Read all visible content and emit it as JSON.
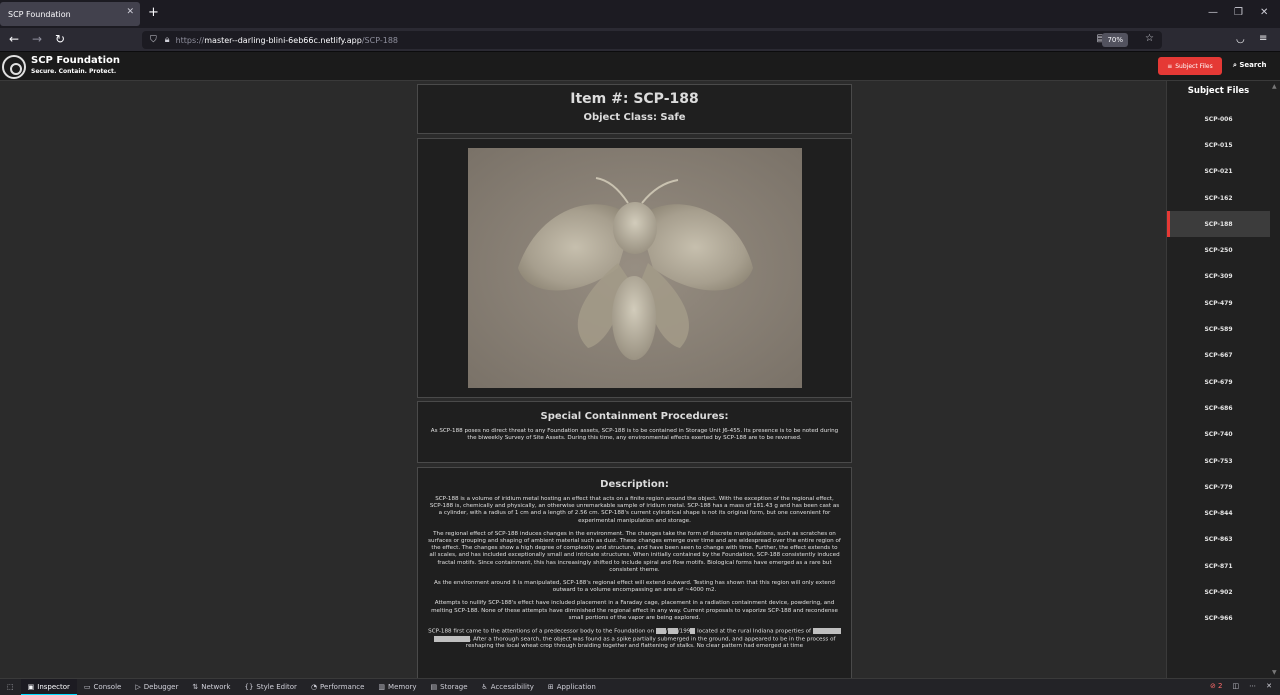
{
  "browser": {
    "tab_title": "SCP Foundation",
    "url_prefix": "https://",
    "url_host": "master--darling-blini-6eb66c.netlify.app",
    "url_path": "/SCP-188",
    "zoom": "70%"
  },
  "site": {
    "title": "SCP Foundation",
    "tagline": "Secure. Contain. Protect.",
    "subject_files_button": "Subject Files",
    "search_label": "Search"
  },
  "item": {
    "number": "Item #: SCP-188",
    "object_class": "Object Class: Safe"
  },
  "containment": {
    "heading": "Special Containment Procedures:",
    "text": "As SCP-188 poses no direct threat to any Foundation assets, SCP-188 is to be contained in Storage Unit J6-455. Its presence is to be noted during the biweekly Survey of Site Assets. During this time, any environmental effects exerted by SCP-188 are to be reversed."
  },
  "description": {
    "heading": "Description:",
    "p1": "SCP-188 is a volume of iridium metal hosting an effect that acts on a finite region around the object. With the exception of the regional effect, SCP-188 is, chemically and physically, an otherwise unremarkable sample of iridium metal. SCP-188 has a mass of 181.43 g and has been cast as a cylinder, with a radius of 1 cm and a length of 2.56 cm. SCP-188's current cylindrical shape is not its original form, but one convenient for experimental manipulation and storage.",
    "p2": "The regional effect of SCP-188 induces changes in the environment. The changes take the form of discrete manipulations, such as scratches on surfaces or grouping and shaping of ambient material such as dust. These changes emerge over time and are widespread over the entire region of the effect. The changes show a high degree of complexity and structure, and have been seen to change with time. Further, the effect extends to all scales, and has included exceptionally small and intricate structures. When initially contained by the Foundation, SCP-188 consistently induced fractal motifs. Since containment, this has increasingly shifted to include spiral and flow motifs. Biological forms have emerged as a rare but consistent theme.",
    "p3": "As the environment around it is manipulated, SCP-188's regional effect will extend outward. Testing has shown that this region will only extend outward to a volume encompassing an area of ~4000 m2.",
    "p4": "Attempts to nullify SCP-188's effect have included placement in a Faraday cage, placement in a radiation containment device, powdering, and melting SCP-188. None of these attempts have diminished the regional effect in any way. Current proposals to vaporize SCP-188 and recondense small portions of the vapor are being explored.",
    "p5_a": "SCP-188 first came to the attentions of a predecessor body to the Foundation on",
    "p5_b": "/199",
    "p5_c": "located at the rural Indiana properties of",
    "p5_d": ". After a thorough search, the object was found as a spike partially submerged in the ground, and appeared to be in the process of reshaping the local wheat crop through braiding together and flattening of stalks. No clear pattern had emerged at time"
  },
  "sidebar": {
    "heading": "Subject Files",
    "items": [
      "SCP-006",
      "SCP-015",
      "SCP-021",
      "SCP-162",
      "SCP-188",
      "SCP-250",
      "SCP-309",
      "SCP-479",
      "SCP-589",
      "SCP-667",
      "SCP-679",
      "SCP-686",
      "SCP-740",
      "SCP-753",
      "SCP-779",
      "SCP-844",
      "SCP-863",
      "SCP-871",
      "SCP-902",
      "SCP-966"
    ],
    "active": "SCP-188"
  },
  "devtools": {
    "tabs": [
      "Inspector",
      "Console",
      "Debugger",
      "Network",
      "Style Editor",
      "Performance",
      "Memory",
      "Storage",
      "Accessibility",
      "Application"
    ],
    "error_count": "2"
  }
}
